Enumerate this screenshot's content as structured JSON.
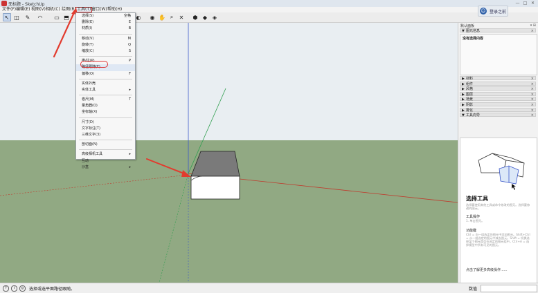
{
  "window": {
    "title": "无标题 - SketchUp",
    "controls": [
      "—",
      "□",
      "✕"
    ]
  },
  "menu": [
    {
      "id": "file",
      "label": "文件(F)"
    },
    {
      "id": "edit",
      "label": "编辑(E)"
    },
    {
      "id": "view",
      "label": "视图(V)"
    },
    {
      "id": "camera",
      "label": "相机(C)"
    },
    {
      "id": "draw",
      "label": "绘图(R)"
    },
    {
      "id": "tools",
      "label": "工具(T)"
    },
    {
      "id": "window",
      "label": "窗口(W)"
    },
    {
      "id": "help",
      "label": "帮助(H)"
    }
  ],
  "tools_menu": {
    "items": [
      {
        "label": "选择(S)",
        "shortcut": "空格"
      },
      {
        "label": "删除(E)",
        "shortcut": "E"
      },
      {
        "label": "材质(I)",
        "shortcut": "B"
      },
      {
        "sep": true
      },
      {
        "label": "移动(V)",
        "shortcut": "M"
      },
      {
        "label": "旋转(T)",
        "shortcut": "Q"
      },
      {
        "label": "缩放(C)",
        "shortcut": "S"
      },
      {
        "sep": true
      },
      {
        "label": "推/拉(P)",
        "shortcut": "P"
      },
      {
        "label": "路径跟随(F)",
        "shortcut": "",
        "highlight": true
      },
      {
        "label": "偏移(O)",
        "shortcut": "F"
      },
      {
        "sep": true
      },
      {
        "label": "实体外壳",
        "shortcut": ""
      },
      {
        "label": "实体工具",
        "shortcut": "",
        "submenu": true
      },
      {
        "sep": true
      },
      {
        "label": "卷尺(M)",
        "shortcut": "T"
      },
      {
        "label": "量角器(O)",
        "shortcut": ""
      },
      {
        "label": "坐标轴(X)",
        "shortcut": ""
      },
      {
        "sep": true
      },
      {
        "label": "尺寸(D)",
        "shortcut": ""
      },
      {
        "label": "文字标注(T)",
        "shortcut": ""
      },
      {
        "label": "三维文字(3)",
        "shortcut": ""
      },
      {
        "sep": true
      },
      {
        "label": "剖切面(N)",
        "shortcut": ""
      },
      {
        "sep": true
      },
      {
        "label": "高级相机工具",
        "shortcut": "",
        "submenu": true
      },
      {
        "label": "互动",
        "shortcut": ""
      },
      {
        "label": "沙盒",
        "shortcut": "",
        "submenu": true
      }
    ],
    "submenu_arrow": "▸"
  },
  "toolbar": {
    "tools": [
      {
        "name": "select-tool-icon",
        "glyph": "↖"
      },
      {
        "name": "eraser-tool-icon",
        "glyph": "◫"
      },
      {
        "name": "pencil-tool-icon",
        "glyph": "✎"
      },
      {
        "name": "arc-tool-icon",
        "glyph": "◠"
      },
      {
        "name": "shape-tool-icon",
        "glyph": "▭"
      },
      {
        "name": "push-pull-icon",
        "glyph": "⬒"
      },
      {
        "name": "move-tool-icon",
        "glyph": "✥"
      },
      {
        "name": "rotate-tool-icon",
        "glyph": "⟳"
      },
      {
        "name": "scale-tool-icon",
        "glyph": "⤡"
      },
      {
        "name": "tape-measure-icon",
        "glyph": "⌇"
      },
      {
        "name": "text-tool-icon",
        "glyph": "A"
      },
      {
        "name": "paint-bucket-icon",
        "glyph": "◐"
      },
      {
        "name": "orbit-icon",
        "glyph": "◉"
      },
      {
        "name": "pan-icon",
        "glyph": "✋"
      },
      {
        "name": "zoom-icon",
        "glyph": "⌕"
      },
      {
        "name": "zoom-extents-icon",
        "glyph": "✕"
      },
      {
        "name": "warehouse-icon",
        "glyph": "⬢"
      },
      {
        "name": "extension-icon",
        "glyph": "◆"
      },
      {
        "name": "ruby-icon",
        "glyph": "◈"
      }
    ]
  },
  "account": {
    "avatar": "☺",
    "label": "登录之前"
  },
  "tray": {
    "title": "默认面板",
    "pin": "▾ ⊞",
    "entity_info": {
      "label": "图元信息",
      "content": "没有选择内容"
    },
    "panels": [
      "材料",
      "组件",
      "风格",
      "图层",
      "场景",
      "阴影",
      "雾化",
      "工具向导"
    ],
    "instructor": {
      "heading": "选择工具",
      "description": "选择要使用其他工具或命令修改的图元。选择要修改的图元。",
      "ops_title": "工具操作",
      "ops_text": "1. 单击图元。",
      "keys_title": "功能键",
      "keys_text": "Ctrl = 向一组选定的图元中添加图元。Shift+Ctrl = 从一组选定的图元中减去图元。Shift = 切换选择某个图元是否在选定的图元组中。Ctrl+A = 选择模型中所有可见的图元。",
      "more": "点击了解更多高级操作......"
    }
  },
  "status": {
    "icons": [
      "?",
      "i",
      "◎"
    ],
    "message": "选择或选平面路径跟随。",
    "measure_label": "数值",
    "measure_value": ""
  },
  "colors": {
    "sky": "#e9eef2",
    "ground": "#91a983",
    "box_top": "#7a7a7a",
    "box_front": "#ffffff",
    "axis_red": "#c0392b",
    "axis_green": "#2e9e4e",
    "axis_blue": "#3a57c9",
    "annotation": "#e23b2e"
  }
}
